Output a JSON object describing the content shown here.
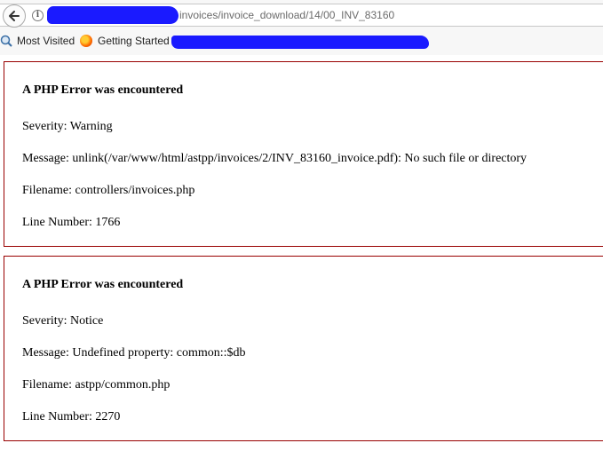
{
  "browser": {
    "url_visible": "invoices/invoice_download/14/00_INV_83160",
    "bookmarks": [
      {
        "label": "Most Visited"
      },
      {
        "label": "Getting Started"
      }
    ]
  },
  "errors": [
    {
      "title": "A PHP Error was encountered",
      "severity": "Severity: Warning",
      "message": "Message: unlink(/var/www/html/astpp/invoices/2/INV_83160_invoice.pdf): No such file or directory",
      "filename": "Filename: controllers/invoices.php",
      "line": "Line Number: 1766"
    },
    {
      "title": "A PHP Error was encountered",
      "severity": "Severity: Notice",
      "message": "Message: Undefined property: common::$db",
      "filename": "Filename: astpp/common.php",
      "line": "Line Number: 2270"
    }
  ],
  "colors": {
    "error_border": "#990000",
    "redaction": "#1a1aff"
  }
}
